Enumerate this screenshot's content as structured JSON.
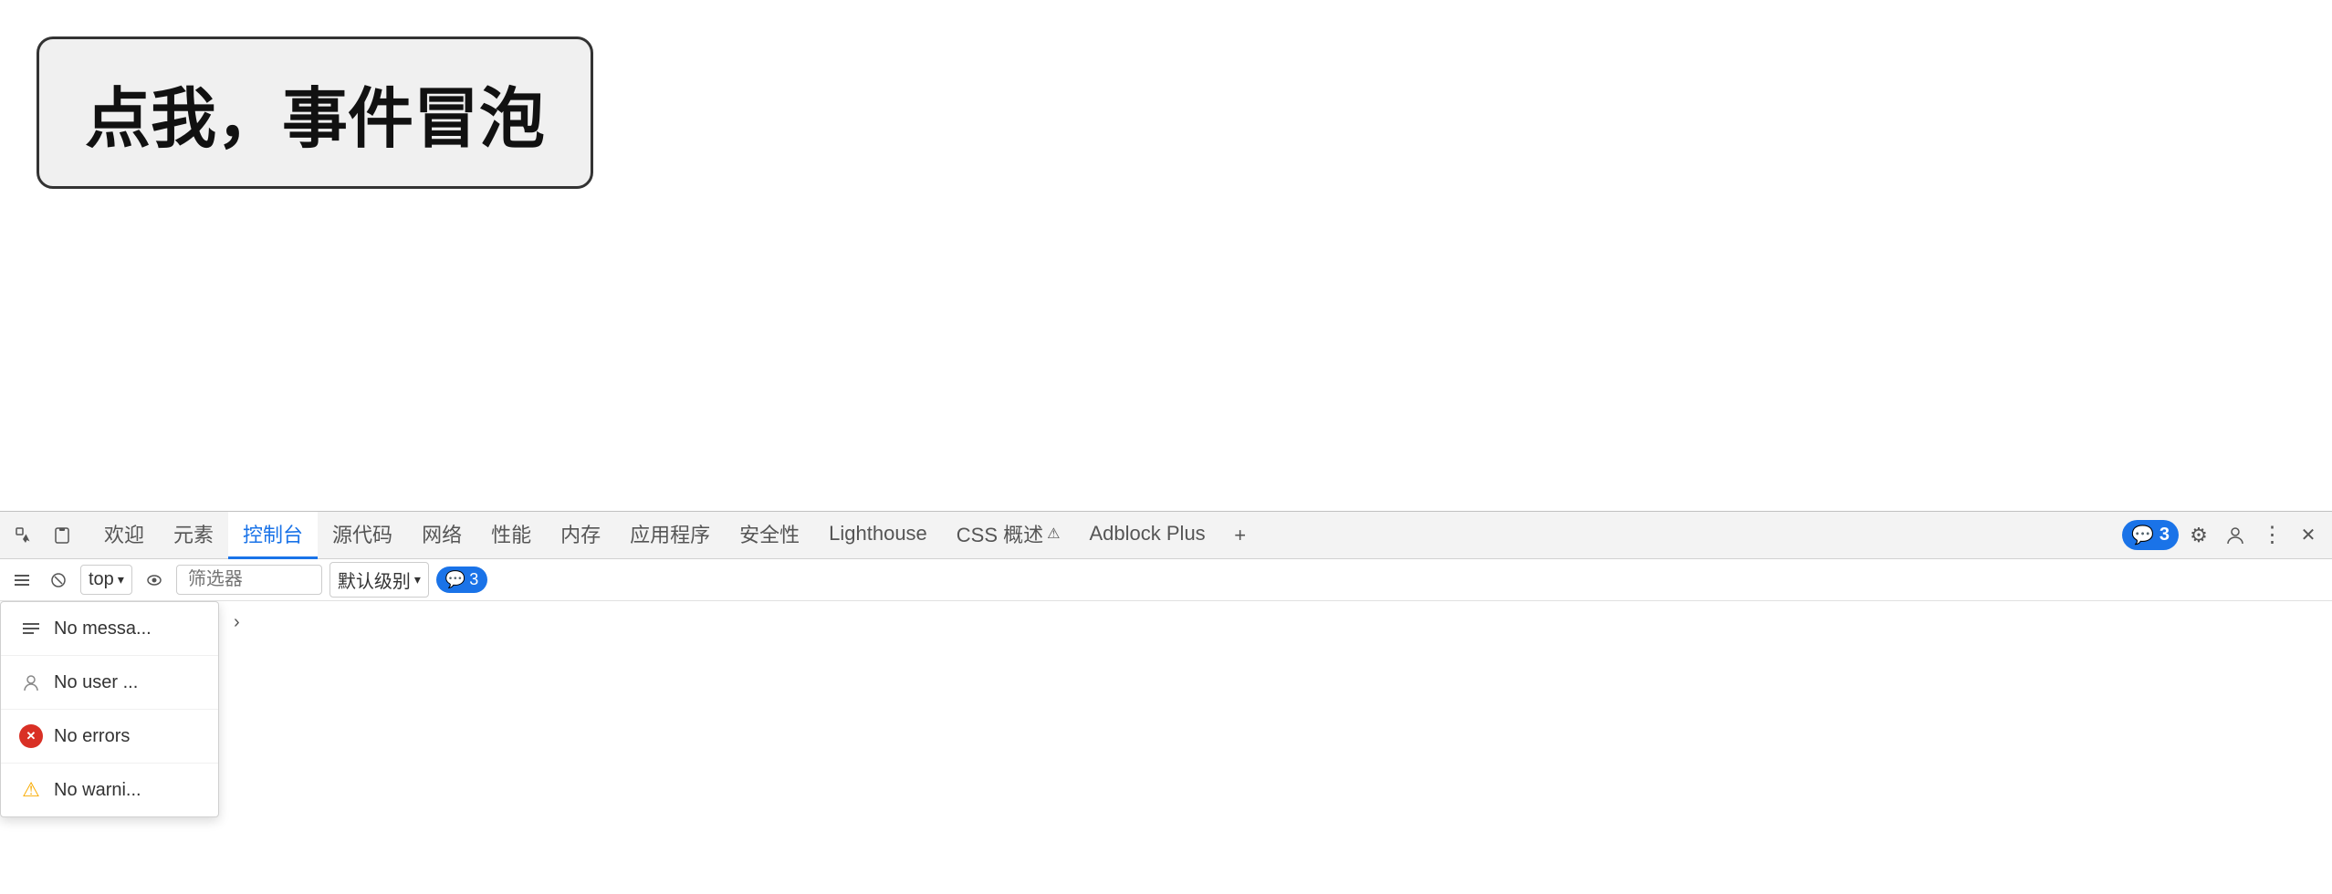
{
  "browser": {
    "content": {
      "button_label": "点我，事件冒泡"
    }
  },
  "devtools": {
    "tabs": [
      {
        "id": "welcome",
        "label": "欢迎",
        "active": false
      },
      {
        "id": "elements",
        "label": "元素",
        "active": false
      },
      {
        "id": "console",
        "label": "控制台",
        "active": true
      },
      {
        "id": "sources",
        "label": "源代码",
        "active": false
      },
      {
        "id": "network",
        "label": "网络",
        "active": false
      },
      {
        "id": "performance",
        "label": "性能",
        "active": false
      },
      {
        "id": "memory",
        "label": "内存",
        "active": false
      },
      {
        "id": "application",
        "label": "应用程序",
        "active": false
      },
      {
        "id": "security",
        "label": "安全性",
        "active": false
      },
      {
        "id": "lighthouse",
        "label": "Lighthouse",
        "active": false
      },
      {
        "id": "css-overview",
        "label": "CSS 概述",
        "active": false
      },
      {
        "id": "adblock",
        "label": "Adblock Plus",
        "active": false
      }
    ],
    "toolbar": {
      "context_label": "top",
      "filter_placeholder": "筛选器",
      "level_label": "默认级别",
      "badge_count": "3"
    },
    "right_buttons": {
      "messages_badge_count": "3",
      "settings_icon": "⚙",
      "person_icon": "👤",
      "more_icon": "⋮",
      "close_icon": "✕"
    },
    "dropdown": {
      "items": [
        {
          "id": "all-messages",
          "icon": "≡",
          "label": "No messa...",
          "icon_type": "messages"
        },
        {
          "id": "user-messages",
          "icon": "👤",
          "label": "No user ...",
          "icon_type": "user"
        },
        {
          "id": "errors",
          "icon": "✕",
          "label": "No errors",
          "icon_type": "error"
        },
        {
          "id": "warnings",
          "icon": "⚠",
          "label": "No warni...",
          "icon_type": "warning"
        }
      ]
    }
  }
}
